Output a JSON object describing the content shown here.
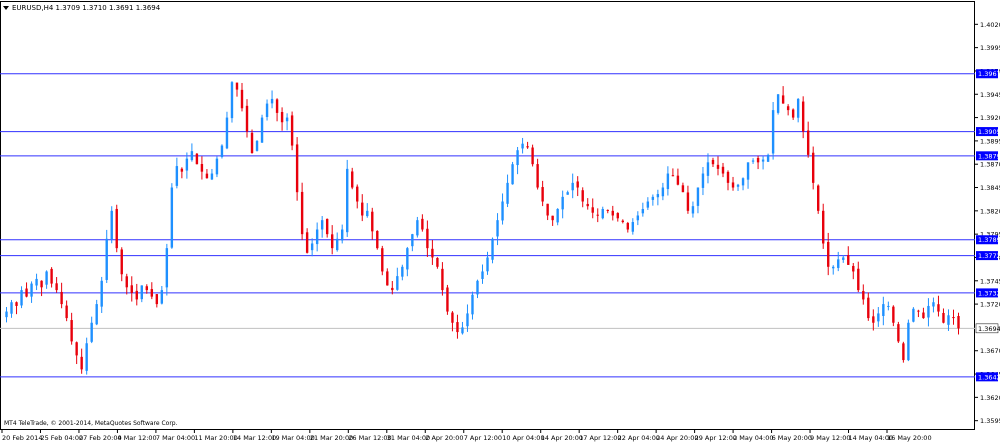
{
  "window": {
    "symbol_header": "EURUSD,H4  1.3709 1.3710 1.3691 1.3694",
    "watermark": "MT4 TeleTrade, © 2001-2014, MetaQuotes Software Corp."
  },
  "colors": {
    "bull": "#1e90ff",
    "bear": "#e8000b",
    "level": "#3030ff",
    "label_bg": "#0000ff",
    "label_text": "#ffffff",
    "axis": "#000000"
  },
  "chart_data": {
    "type": "candlestick",
    "title": "EURUSD,H4",
    "ylim": [
      1.3585,
      1.4045
    ],
    "y_ticks": [
      "1.4020",
      "1.3995",
      "1.3970",
      "1.3945",
      "1.3920",
      "1.3895",
      "1.3870",
      "1.3845",
      "1.3820",
      "1.3795",
      "1.3770",
      "1.3745",
      "1.3720",
      "1.3670",
      "1.3645",
      "1.3620",
      "1.3595"
    ],
    "x_labels": [
      "20 Feb 2014",
      "25 Feb 04:00",
      "27 Feb 20:00",
      "4 Mar 12:00",
      "7 Mar 04:00",
      "11 Mar 20:00",
      "14 Mar 12:00",
      "19 Mar 04:00",
      "21 Mar 20:00",
      "26 Mar 12:00",
      "31 Mar 04:00",
      "2 Apr 20:00",
      "7 Apr 12:00",
      "10 Apr 04:00",
      "14 Apr 20:00",
      "17 Apr 12:00",
      "22 Apr 04:00",
      "24 Apr 20:00",
      "29 Apr 12:00",
      "2 May 04:00",
      "6 May 20:00",
      "9 May 12:00",
      "14 May 04:00",
      "16 May 20:00"
    ],
    "horizontal_levels": [
      {
        "value": 1.3967,
        "label": "1.3967"
      },
      {
        "value": 1.3905,
        "label": "1.3905"
      },
      {
        "value": 1.3879,
        "label": "1.3879"
      },
      {
        "value": 1.3789,
        "label": "1.3789"
      },
      {
        "value": 1.3772,
        "label": "1.3772"
      },
      {
        "value": 1.3732,
        "label": "1.3732"
      },
      {
        "value": 1.3642,
        "label": "1.3642"
      }
    ],
    "current_price": {
      "value": 1.3694,
      "label": "1.3694"
    },
    "closes": [
      1.3712,
      1.3722,
      1.3718,
      1.3735,
      1.3728,
      1.3742,
      1.3747,
      1.3738,
      1.3755,
      1.3742,
      1.3735,
      1.372,
      1.3705,
      1.368,
      1.3665,
      1.365,
      1.3678,
      1.37,
      1.372,
      1.3745,
      1.379,
      1.382,
      1.378,
      1.3752,
      1.3738,
      1.3732,
      1.3725,
      1.374,
      1.3735,
      1.3728,
      1.372,
      1.3735,
      1.378,
      1.3845,
      1.3868,
      1.3862,
      1.3876,
      1.3884,
      1.387,
      1.3862,
      1.3855,
      1.386,
      1.3876,
      1.389,
      1.392,
      1.3958,
      1.395,
      1.393,
      1.3905,
      1.3882,
      1.3895,
      1.392,
      1.3935,
      1.394,
      1.3925,
      1.3915,
      1.392,
      1.389,
      1.384,
      1.3795,
      1.3775,
      1.3785,
      1.38,
      1.381,
      1.3795,
      1.378,
      1.379,
      1.38,
      1.3865,
      1.3845,
      1.383,
      1.3815,
      1.382,
      1.3798,
      1.378,
      1.3755,
      1.374,
      1.3735,
      1.375,
      1.376,
      1.378,
      1.3795,
      1.381,
      1.38,
      1.378,
      1.377,
      1.376,
      1.3735,
      1.3712,
      1.37,
      1.369,
      1.3695,
      1.371,
      1.373,
      1.3745,
      1.3755,
      1.377,
      1.379,
      1.381,
      1.383,
      1.385,
      1.387,
      1.3885,
      1.3892,
      1.3888,
      1.387,
      1.3845,
      1.383,
      1.3815,
      1.381,
      1.3822,
      1.3835,
      1.384,
      1.385,
      1.3845,
      1.383,
      1.3825,
      1.3818,
      1.3815,
      1.3822,
      1.382,
      1.3815,
      1.3812,
      1.3808,
      1.38,
      1.3808,
      1.3815,
      1.3822,
      1.383,
      1.3835,
      1.3838,
      1.3845,
      1.386,
      1.3858,
      1.3848,
      1.384,
      1.382,
      1.3825,
      1.3845,
      1.386,
      1.3872,
      1.387,
      1.3865,
      1.386,
      1.385,
      1.3845,
      1.3848,
      1.3855,
      1.3872,
      1.3874,
      1.3872,
      1.3875,
      1.388,
      1.3928,
      1.3945,
      1.3935,
      1.3928,
      1.392,
      1.394,
      1.3905,
      1.388,
      1.385,
      1.382,
      1.3785,
      1.376,
      1.376,
      1.3768,
      1.377,
      1.3762,
      1.3755,
      1.3735,
      1.3725,
      1.3705,
      1.37,
      1.371,
      1.372,
      1.3718,
      1.37,
      1.368,
      1.366,
      1.37,
      1.3715,
      1.3712,
      1.3705,
      1.3718,
      1.3722,
      1.3712,
      1.37,
      1.3708,
      1.3705,
      1.3694
    ]
  }
}
